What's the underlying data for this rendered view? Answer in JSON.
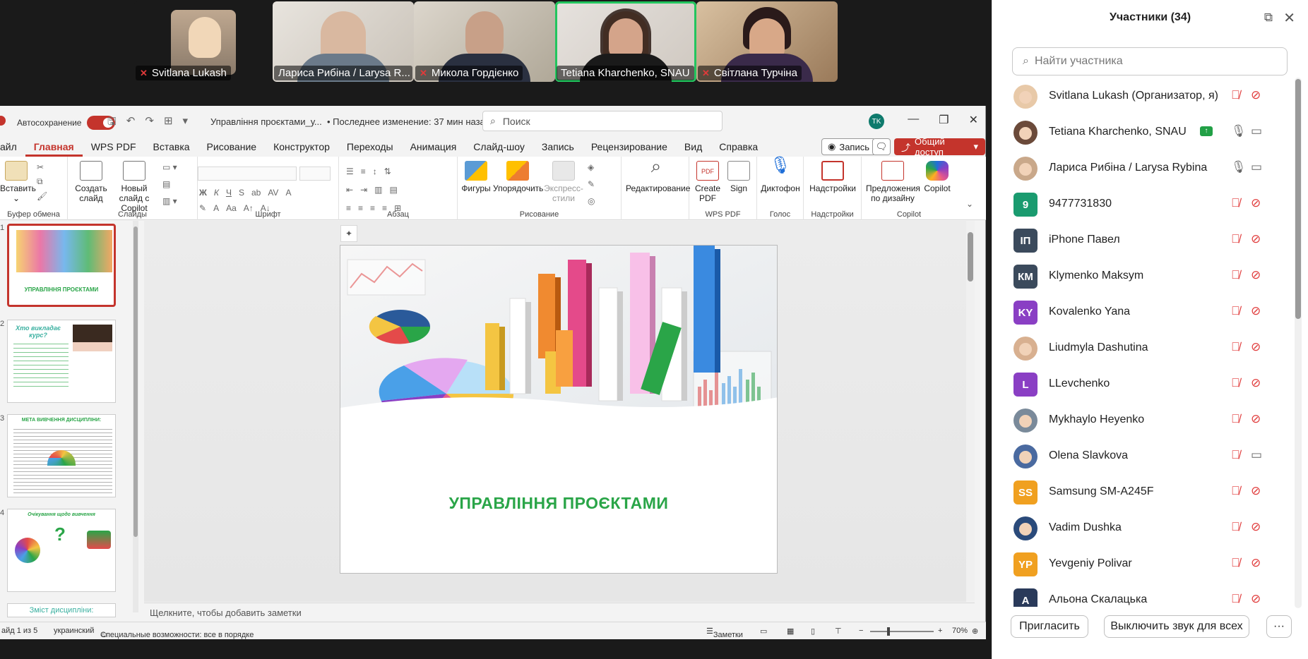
{
  "video_strip": {
    "tiles": [
      {
        "name": "Svitlana Lukash"
      },
      {
        "name": "Лариса Рибіна / Larysa R..."
      },
      {
        "name": "Микола Гордієнко"
      },
      {
        "name": "Tetiana Kharchenko, SNAU"
      },
      {
        "name": "Світлана Турчіна"
      }
    ]
  },
  "ppt": {
    "autosave_label": "Автосохранение",
    "doc_name": "Управління проєктами_у...",
    "doc_modified": "• Последнее изменение: 37 мин назад",
    "search_placeholder": "Поиск",
    "avatar_initials": "TK",
    "tabs": [
      "айл",
      "Главная",
      "WPS PDF",
      "Вставка",
      "Рисование",
      "Конструктор",
      "Переходы",
      "Анимация",
      "Слайд-шоу",
      "Запись",
      "Рецензирование",
      "Вид",
      "Справка"
    ],
    "record_label": "Запись",
    "share_label": "Общий доступ",
    "ribbon": {
      "paste": "Вставить",
      "new_slide": "Создать слайд",
      "new_slide_copilot": "Новый слайд с Copilot",
      "shapes": "Фигуры",
      "arrange": "Упорядочить",
      "quick_styles": "Экспресс-стили",
      "editing": "Редактирование",
      "create_pdf": "Create PDF",
      "sign": "Sign",
      "dictate": "Диктофон",
      "addins": "Надстройки",
      "designer": "Предложения по дизайну",
      "copilot": "Copilot",
      "groups": {
        "clipboard": "Буфер обмена",
        "slides": "Слайды",
        "font": "Шрифт",
        "paragraph": "Абзац",
        "drawing": "Рисование",
        "wps_pdf": "WPS PDF",
        "voice": "Голос",
        "addins": "Надстройки",
        "copilot": "Copilot"
      }
    },
    "thumbnails": [
      {
        "caption": "УПРАВЛІННЯ ПРОЄКТАМИ"
      },
      {
        "caption": "Хто викладає курс?"
      },
      {
        "caption": "МЕТА ВИВЧЕННЯ ДИСЦИПЛІНИ:"
      },
      {
        "caption": "Очікування щодо вивчення"
      },
      {
        "caption": "Зміст дисципліни:"
      }
    ],
    "slide_title": "УПРАВЛІННЯ ПРОЄКТАМИ",
    "notes_placeholder": "Щелкните, чтобы добавить заметки",
    "status": {
      "slide_count": "айд 1 из 5",
      "language": "украинский",
      "accessibility": "Специальные возможности: все в порядке",
      "notes": "Заметки",
      "zoom": "70%"
    }
  },
  "participants": {
    "title": "Участники (34)",
    "search_placeholder": "Найти участника",
    "list": [
      {
        "name": "Svitlana Lukash (Организатор, я)",
        "initials": "",
        "color": "#e8c9a8",
        "mic": "off",
        "video": "off"
      },
      {
        "name": "Tetiana Kharchenko, SNAU",
        "initials": "",
        "color": "#6b4a3a",
        "mic": "on",
        "video": "on",
        "sharing": true
      },
      {
        "name": "Лариса Рибіна / Larysa Rybina",
        "initials": "",
        "color": "#c9a88a",
        "mic": "on",
        "video": "on"
      },
      {
        "name": "9477731830",
        "initials": "9",
        "color": "#1a9b6f",
        "mic": "off",
        "video": "off"
      },
      {
        "name": "iPhone Павел",
        "initials": "ІП",
        "color": "#3b4a5c",
        "mic": "off",
        "video": "off"
      },
      {
        "name": "Klymenko Maksym",
        "initials": "КМ",
        "color": "#3b4a5c",
        "mic": "off",
        "video": "off"
      },
      {
        "name": "Kovalenko Yana",
        "initials": "KY",
        "color": "#8a3fc4",
        "mic": "off",
        "video": "off"
      },
      {
        "name": "Liudmyla Dashutina",
        "initials": "",
        "color": "#d8b090",
        "mic": "off",
        "video": "off"
      },
      {
        "name": "LLevchenko",
        "initials": "L",
        "color": "#8a3fc4",
        "mic": "off",
        "video": "off"
      },
      {
        "name": "Mykhaylo Heyenko",
        "initials": "",
        "color": "#7a8a9a",
        "mic": "off",
        "video": "off"
      },
      {
        "name": "Olena Slavkova",
        "initials": "",
        "color": "#4a6aa0",
        "mic": "off",
        "video": "on"
      },
      {
        "name": "Samsung SM-A245F",
        "initials": "SS",
        "color": "#f0a020",
        "mic": "off",
        "video": "off"
      },
      {
        "name": "Vadim Dushka",
        "initials": "",
        "color": "#2a4a7a",
        "mic": "off",
        "video": "off"
      },
      {
        "name": "Yevgeniy Polivar",
        "initials": "YP",
        "color": "#f0a020",
        "mic": "off",
        "video": "off"
      },
      {
        "name": "Альона Скалацька",
        "initials": "А",
        "color": "#2a3a5a",
        "mic": "off",
        "video": "off"
      }
    ],
    "invite_label": "Пригласить",
    "mute_all_label": "Выключить звук для всех",
    "more_label": "···"
  }
}
